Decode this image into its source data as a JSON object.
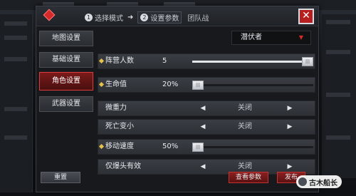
{
  "header": {
    "steps": [
      {
        "num": "1",
        "label": "选择模式"
      },
      {
        "num": "2",
        "label": "设置参数"
      }
    ],
    "mode_name": "团队战",
    "close_label": "✕"
  },
  "tabs": [
    "地图设置",
    "基础设置",
    "角色设置",
    "武器设置"
  ],
  "active_tab": 2,
  "mode_select": {
    "value": "潜伏者"
  },
  "settings": [
    {
      "label": "阵营人数",
      "type": "slider",
      "value": "5",
      "fill": 0.95,
      "highlight": true
    },
    {
      "label": "生命值",
      "type": "slider",
      "value": "20%",
      "fill": 0.0,
      "highlight": true
    },
    {
      "label": "微重力",
      "type": "toggle",
      "value": "关闭",
      "highlight": false
    },
    {
      "label": "死亡变小",
      "type": "toggle",
      "value": "关闭",
      "highlight": false
    },
    {
      "label": "移动速度",
      "type": "slider",
      "value": "50%",
      "fill": 0.0,
      "highlight": true
    },
    {
      "label": "仅爆头有效",
      "type": "toggle",
      "value": "关闭",
      "highlight": false
    }
  ],
  "buttons": {
    "reset": "重置",
    "view_params": "查看参数",
    "publish": "发布"
  },
  "watermark": {
    "text": "古木船长"
  },
  "colors": {
    "accent": "#d42a2a",
    "bullet": "#e6c24a"
  }
}
